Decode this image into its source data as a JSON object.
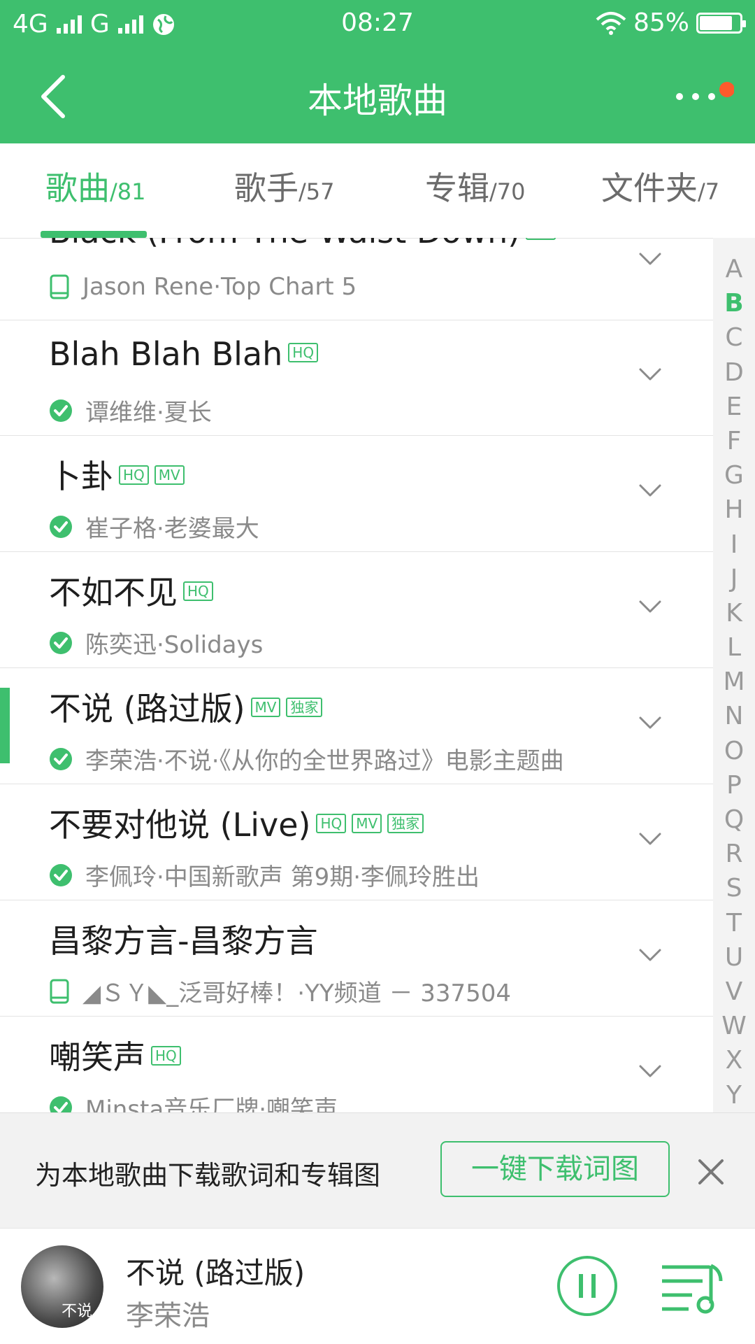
{
  "status_bar": {
    "network1": "4G",
    "network2": "G",
    "time": "08:27",
    "battery": "85%",
    "battery_level": 0.85
  },
  "header": {
    "title": "本地歌曲"
  },
  "tabs": [
    {
      "label": "歌曲",
      "count": "/81",
      "active": true
    },
    {
      "label": "歌手",
      "count": "/57",
      "active": false
    },
    {
      "label": "专辑",
      "count": "/70",
      "active": false
    },
    {
      "label": "文件夹",
      "count": "/7",
      "active": false
    }
  ],
  "songs": [
    {
      "title": "Black (From The Waist Down)",
      "badges": [
        "HQ"
      ],
      "subtitle": "Jason Rene·Top Chart 5",
      "icon": "device-icon"
    },
    {
      "title": "Blah Blah Blah",
      "badges": [
        "HQ"
      ],
      "subtitle": "谭维维·夏长",
      "icon": "check-icon"
    },
    {
      "title": "卜卦",
      "badges": [
        "HQ",
        "MV"
      ],
      "subtitle": "崔子格·老婆最大",
      "icon": "check-icon"
    },
    {
      "title": "不如不见",
      "badges": [
        "HQ"
      ],
      "subtitle": "陈奕迅·Solidays",
      "icon": "check-icon"
    },
    {
      "title": "不说 (路过版)",
      "badges": [
        "MV",
        "独家"
      ],
      "subtitle": "李荣浩·不说·《从你的全世界路过》电影主题曲",
      "icon": "check-icon",
      "playing": true
    },
    {
      "title": "不要对他说 (Live)",
      "badges": [
        "HQ",
        "MV",
        "独家"
      ],
      "subtitle": "李佩玲·中国新歌声 第9期·李佩玲胜出",
      "icon": "check-icon"
    },
    {
      "title": "昌黎方言-昌黎方言",
      "badges": [],
      "subtitle": "◢ＳＹ◣_泛哥好棒！·YY频道 － 337504",
      "icon": "device-icon"
    },
    {
      "title": "嘲笑声",
      "badges": [
        "HQ"
      ],
      "subtitle": "Minsta音乐厂牌·嘲笑声",
      "icon": "check-icon"
    }
  ],
  "index_letters": [
    "A",
    "B",
    "C",
    "D",
    "E",
    "F",
    "G",
    "H",
    "I",
    "J",
    "K",
    "L",
    "M",
    "N",
    "O",
    "P",
    "Q",
    "R",
    "S",
    "T",
    "U",
    "V",
    "W",
    "X",
    "Y"
  ],
  "index_active": "B",
  "banner": {
    "text": "为本地歌曲下载歌词和专辑图",
    "button": "一键下载词图"
  },
  "player": {
    "title": "不说 (路过版)",
    "artist": "李荣浩",
    "album_text": "不说"
  },
  "colors": {
    "accent": "#3ebf6e",
    "notification_dot": "#ff5a2c"
  }
}
